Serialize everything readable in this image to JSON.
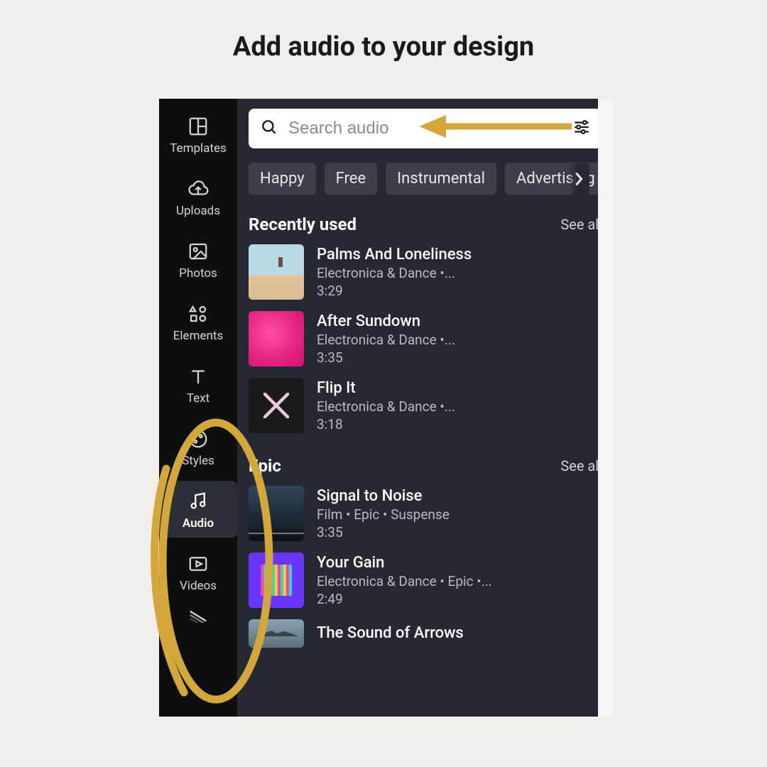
{
  "page": {
    "title": "Add audio to your design"
  },
  "annotation_color": "#D4A73B",
  "sidebar": {
    "items": [
      {
        "label": "Templates",
        "icon": "templates-icon"
      },
      {
        "label": "Uploads",
        "icon": "uploads-icon"
      },
      {
        "label": "Photos",
        "icon": "photos-icon"
      },
      {
        "label": "Elements",
        "icon": "elements-icon"
      },
      {
        "label": "Text",
        "icon": "text-icon"
      },
      {
        "label": "Styles",
        "icon": "styles-icon"
      },
      {
        "label": "Audio",
        "icon": "audio-icon",
        "active": true
      },
      {
        "label": "Videos",
        "icon": "videos-icon"
      }
    ]
  },
  "search": {
    "placeholder": "Search audio"
  },
  "filter_icon": "sliders-icon",
  "chips": [
    "Happy",
    "Free",
    "Instrumental",
    "Advertising"
  ],
  "sections": [
    {
      "title": "Recently used",
      "see_all": "See all",
      "tracks": [
        {
          "title": "Palms And Loneliness",
          "meta": "Electronica & Dance •...",
          "duration": "3:29",
          "cover": "cov-beach"
        },
        {
          "title": "After Sundown",
          "meta": "Electronica & Dance •...",
          "duration": "3:35",
          "cover": "cov-pink"
        },
        {
          "title": "Flip It",
          "meta": "Electronica & Dance •...",
          "duration": "3:18",
          "cover": "cov-flip"
        }
      ]
    },
    {
      "title": "Epic",
      "see_all": "See all",
      "tracks": [
        {
          "title": "Signal to Noise",
          "meta": "Film • Epic • Suspense",
          "duration": "3:35",
          "cover": "cov-signal"
        },
        {
          "title": "Your Gain",
          "meta": "Electronica & Dance • Epic •...",
          "duration": "2:49",
          "cover": "cov-gain"
        },
        {
          "title": "The Sound of Arrows",
          "meta": "",
          "duration": "",
          "cover": "cov-arrows"
        }
      ]
    }
  ]
}
